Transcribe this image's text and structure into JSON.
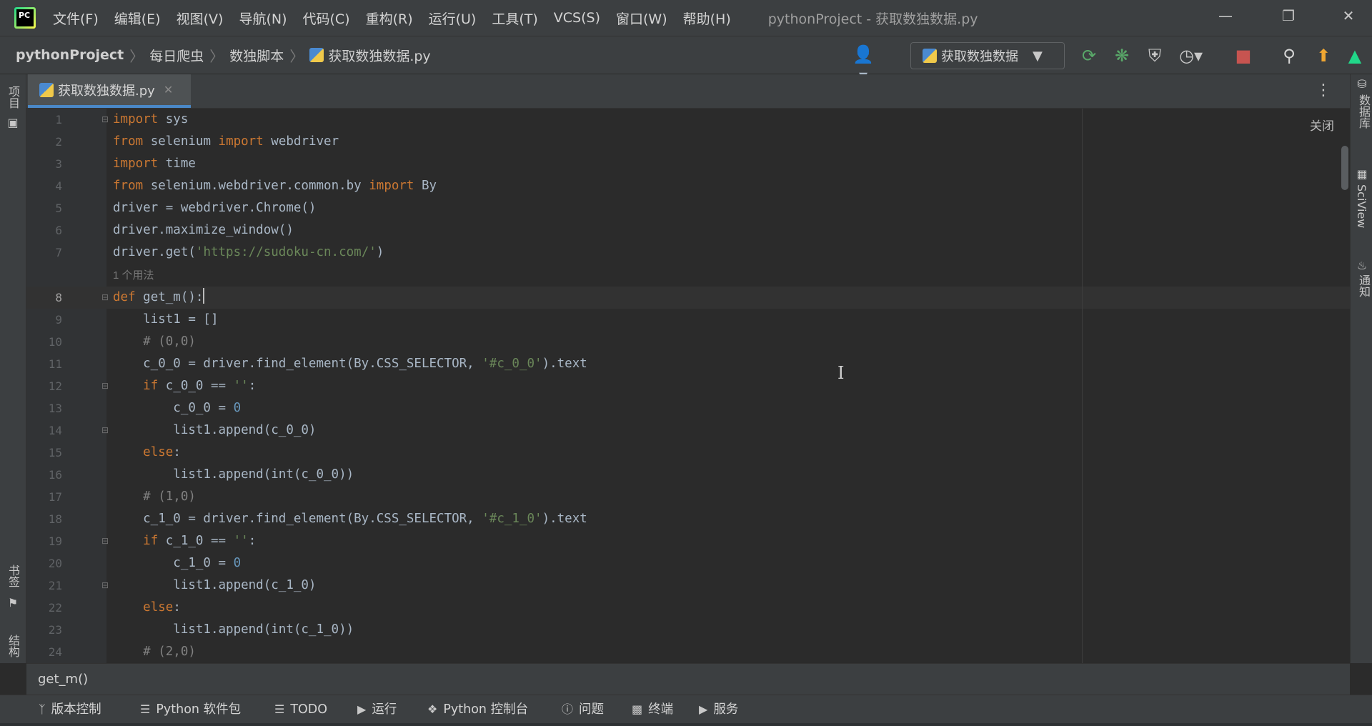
{
  "menubar": {
    "items": [
      "文件(F)",
      "编辑(E)",
      "视图(V)",
      "导航(N)",
      "代码(C)",
      "重构(R)",
      "运行(U)",
      "工具(T)",
      "VCS(S)",
      "窗口(W)",
      "帮助(H)"
    ],
    "window_title": "pythonProject - 获取数独数据.py"
  },
  "navbar": {
    "breadcrumbs": [
      "pythonProject",
      "每日爬虫",
      "数独脚本",
      "获取数独数据.py"
    ],
    "run_config": "获取数独数据"
  },
  "tabs": [
    {
      "label": "获取数独数据.py",
      "active": true
    }
  ],
  "left_strip": {
    "project": "项目",
    "bookmarks": "书签",
    "structure": "结构"
  },
  "right_strip": {
    "database": "数据库",
    "sciview": "SciView",
    "notifications": "通知"
  },
  "editor": {
    "close_hint": "关闭",
    "usage_hint": "1 个用法",
    "current_line": 8,
    "line_numbers": [
      "1",
      "2",
      "3",
      "4",
      "5",
      "6",
      "7",
      "8",
      "9",
      "10",
      "11",
      "12",
      "13",
      "14",
      "15",
      "16",
      "17",
      "18",
      "19",
      "20",
      "21",
      "22",
      "23",
      "24"
    ],
    "code": {
      "l1": "sys",
      "l2a": "selenium ",
      "l2b": "webdriver",
      "l3": "time",
      "l4a": "selenium.webdriver.common.by ",
      "l4b": "By",
      "l5": "driver = webdriver.Chrome()",
      "l6": "driver.maximize_window()",
      "l7a": "driver.get(",
      "l7b": "'https://sudoku-cn.com/'",
      "l7c": ")",
      "l8": "get_m():",
      "l9": "    list1 = []",
      "l10": "    # (0,0)",
      "l11a": "    c_0_0 = driver.find_element(By.CSS_SELECTOR, ",
      "l11b": "'#c_0_0'",
      "l11c": ").text",
      "l12a": "c_0_0 == ",
      "l12b": "''",
      "l12c": ":",
      "l13a": "        c_0_0 = ",
      "l13b": "0",
      "l14": "        list1.append(c_0_0)",
      "l16": "        list1.append(int(c_0_0))",
      "l17": "    # (1,0)",
      "l18a": "    c_1_0 = driver.find_element(By.CSS_SELECTOR, ",
      "l18b": "'#c_1_0'",
      "l18c": ").text",
      "l19a": "c_1_0 == ",
      "l19b": "''",
      "l19c": ":",
      "l20a": "        c_1_0 = ",
      "l20b": "0",
      "l21": "        list1.append(c_1_0)",
      "l23": "        list1.append(int(c_1_0))",
      "l24": "    # (2,0)"
    },
    "keywords": {
      "import": "import",
      "from": "from",
      "def": "def",
      "if": "if",
      "else": "else"
    }
  },
  "code_breadcrumb": "get_m()",
  "bottom_tools": [
    {
      "label": "版本控制",
      "icon": "branch-icon"
    },
    {
      "label": "Python 软件包",
      "icon": "layers-icon"
    },
    {
      "label": "TODO",
      "icon": "list-icon"
    },
    {
      "label": "运行",
      "icon": "play-icon"
    },
    {
      "label": "Python 控制台",
      "icon": "python-icon"
    },
    {
      "label": "问题",
      "icon": "alert-icon"
    },
    {
      "label": "终端",
      "icon": "terminal-icon"
    },
    {
      "label": "服务",
      "icon": "services-icon"
    }
  ],
  "colors": {
    "keyword": "#cc7832",
    "string": "#6a8759",
    "number": "#6897bb",
    "comment": "#808080",
    "accent": "#4a88c7"
  }
}
